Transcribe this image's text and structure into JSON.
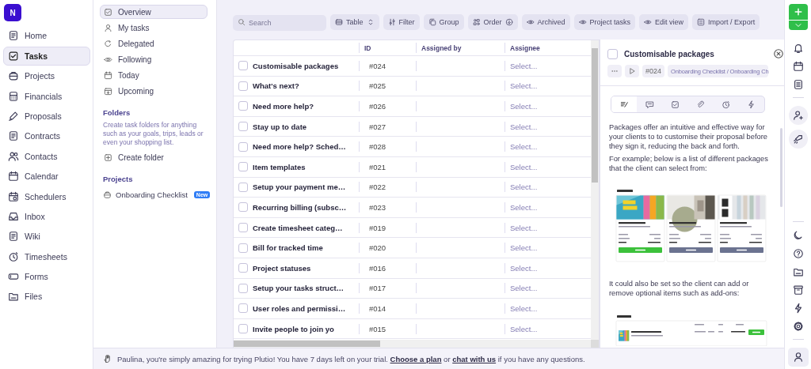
{
  "logo": "N",
  "nav": [
    {
      "label": "Home",
      "selected": false
    },
    {
      "label": "Tasks",
      "selected": true
    },
    {
      "label": "Projects",
      "selected": false
    },
    {
      "label": "Financials",
      "selected": false
    },
    {
      "label": "Proposals",
      "selected": false
    },
    {
      "label": "Contracts",
      "selected": false
    },
    {
      "label": "Contacts",
      "selected": false
    },
    {
      "label": "Calendar",
      "selected": false
    },
    {
      "label": "Schedulers",
      "selected": false
    },
    {
      "label": "Inbox",
      "selected": false
    },
    {
      "label": "Wiki",
      "selected": false
    },
    {
      "label": "Timesheets",
      "selected": false
    },
    {
      "label": "Forms",
      "selected": false
    },
    {
      "label": "Files",
      "selected": false
    }
  ],
  "subnav": [
    {
      "label": "Overview",
      "selected": true
    },
    {
      "label": "My tasks",
      "selected": false
    },
    {
      "label": "Delegated",
      "selected": false
    },
    {
      "label": "Following",
      "selected": false
    },
    {
      "label": "Today",
      "selected": false
    },
    {
      "label": "Upcoming",
      "selected": false
    }
  ],
  "folders": {
    "heading": "Folders",
    "description": "Create task folders for anything such as your goals, trips, leads or even your shopping list.",
    "action": "Create folder"
  },
  "projects": {
    "heading": "Projects",
    "items": [
      {
        "label": "Onboarding Checklist",
        "badge": "New"
      }
    ]
  },
  "toolbar": {
    "search": {
      "placeholder": "Search"
    },
    "buttons": [
      "Table",
      "Filter",
      "Group",
      "Order",
      "Archived",
      "Project tasks",
      "Edit view",
      "Import / Export"
    ]
  },
  "table": {
    "columns": [
      "ID",
      "Assigned by",
      "Assignee"
    ],
    "rows": [
      {
        "name": "Customisable packages",
        "checked": false,
        "id": "#024",
        "assignee": "Select..."
      },
      {
        "name": "What's next?",
        "checked": false,
        "id": "#025",
        "assignee": "Select..."
      },
      {
        "name": "Need more help?",
        "checked": false,
        "id": "#026",
        "assignee": "Select..."
      },
      {
        "name": "Stay up to date",
        "checked": false,
        "id": "#027",
        "assignee": "Select..."
      },
      {
        "name": "Need more help? Sched…",
        "checked": false,
        "id": "#028",
        "assignee": "Select..."
      },
      {
        "name": "Item templates",
        "checked": false,
        "id": "#021",
        "assignee": "Select..."
      },
      {
        "name": "Setup your payment me…",
        "checked": false,
        "id": "#022",
        "assignee": "Select..."
      },
      {
        "name": "Recurring billing (subsc…",
        "checked": false,
        "id": "#023",
        "assignee": "Select..."
      },
      {
        "name": "Create timesheet categ…",
        "checked": false,
        "id": "#019",
        "assignee": "Select..."
      },
      {
        "name": "Bill for tracked time",
        "checked": false,
        "id": "#020",
        "assignee": "Select..."
      },
      {
        "name": "Project statuses",
        "checked": false,
        "id": "#016",
        "assignee": "Select..."
      },
      {
        "name": "Setup your tasks struct…",
        "checked": false,
        "id": "#017",
        "assignee": "Select..."
      },
      {
        "name": "User roles and permissi…",
        "checked": false,
        "id": "#014",
        "assignee": "Select..."
      },
      {
        "name": "Invite people to join yo",
        "checked": false,
        "id": "#015",
        "assignee": "Select..."
      }
    ]
  },
  "detail": {
    "title": "Customisable packages",
    "checked": false,
    "id": "#024",
    "breadcrumb": "Onboarding Checklist / Onboarding Ch",
    "tabs": [
      {
        "selected": true
      },
      {
        "selected": false
      },
      {
        "selected": false
      },
      {
        "selected": false
      },
      {
        "selected": false
      },
      {
        "selected": false
      }
    ],
    "intro": [
      "Packages offer an intuitive and effective way for your clients to to customise their proposal before they sign it, reducing the back and forth.",
      "For example; below is a list of different packages that the client can select from:"
    ],
    "outro": "It could also be set so the client can add or remove optional items such as add-ons:"
  },
  "banner": [
    {
      "text": "Paulina, you're simply amazing for trying Plutio! You have 7 days left on your trial. "
    },
    {
      "link": "Choose a plan"
    },
    {
      "text": " or "
    },
    {
      "link": "chat with us"
    },
    {
      "text": " if you have any questions."
    }
  ]
}
